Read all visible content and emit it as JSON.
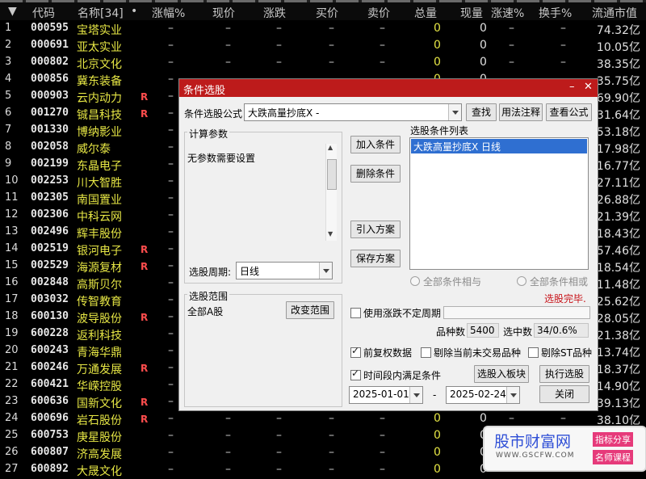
{
  "colors": {
    "header_bg": "#0b0b0b",
    "name": "#e6e645",
    "flag": "#ff4d4d",
    "dialog_title": "#bd1b1b",
    "selected": "#1a2f8a"
  },
  "header": {
    "sort_icon": "▼",
    "cols": [
      "代码",
      "名称[34]",
      "•",
      "涨幅%",
      "现价",
      "涨跌",
      "买价",
      "卖价",
      "总量",
      "现量",
      "涨速%",
      "换手%",
      "流通市值"
    ]
  },
  "rows": [
    {
      "idx": "1",
      "code": "000595",
      "name": "宝塔实业",
      "flag": "",
      "zong": "0",
      "xian": "0",
      "cap": "74.32亿"
    },
    {
      "idx": "2",
      "code": "000691",
      "name": "亚太实业",
      "flag": "",
      "zong": "0",
      "xian": "0",
      "cap": "10.05亿"
    },
    {
      "idx": "3",
      "code": "000802",
      "name": "北京文化",
      "flag": "",
      "zong": "0",
      "xian": "0",
      "cap": "38.35亿"
    },
    {
      "idx": "4",
      "code": "000856",
      "name": "冀东装备",
      "flag": "",
      "zong": "0",
      "xian": "0",
      "cap": "35.75亿"
    },
    {
      "idx": "5",
      "code": "000903",
      "name": "云内动力",
      "flag": "R",
      "zong": "",
      "xian": "",
      "cap": "69.90亿"
    },
    {
      "idx": "6",
      "code": "001270",
      "name": "铖昌科技",
      "flag": "R",
      "zong": "",
      "xian": "",
      "cap": "31.64亿"
    },
    {
      "idx": "7",
      "code": "001330",
      "name": "博纳影业",
      "flag": "",
      "zong": "",
      "xian": "",
      "cap": "53.18亿"
    },
    {
      "idx": "8",
      "code": "002058",
      "name": "威尔泰",
      "flag": "",
      "zong": "",
      "xian": "",
      "cap": "17.98亿"
    },
    {
      "idx": "9",
      "code": "002199",
      "name": "东晶电子",
      "flag": "",
      "zong": "",
      "xian": "",
      "cap": "16.77亿"
    },
    {
      "idx": "10",
      "code": "002253",
      "name": "川大智胜",
      "flag": "",
      "zong": "",
      "xian": "",
      "cap": "27.11亿"
    },
    {
      "idx": "11",
      "code": "002305",
      "name": "南国置业",
      "flag": "",
      "zong": "",
      "xian": "",
      "cap": "26.88亿"
    },
    {
      "idx": "12",
      "code": "002306",
      "name": "中科云网",
      "flag": "",
      "zong": "",
      "xian": "",
      "cap": "21.39亿"
    },
    {
      "idx": "13",
      "code": "002496",
      "name": "辉丰股份",
      "flag": "",
      "zong": "",
      "xian": "",
      "cap": "18.43亿"
    },
    {
      "idx": "14",
      "code": "002519",
      "name": "银河电子",
      "flag": "R",
      "zong": "",
      "xian": "",
      "cap": "57.46亿"
    },
    {
      "idx": "15",
      "code": "002529",
      "name": "海源复材",
      "flag": "R",
      "zong": "",
      "xian": "",
      "cap": "18.54亿"
    },
    {
      "idx": "16",
      "code": "002848",
      "name": "高斯贝尔",
      "flag": "",
      "zong": "",
      "xian": "",
      "cap": "11.48亿"
    },
    {
      "idx": "17",
      "code": "003032",
      "name": "传智教育",
      "flag": "",
      "zong": "",
      "xian": "",
      "cap": "25.62亿"
    },
    {
      "idx": "18",
      "code": "600130",
      "name": "波导股份",
      "flag": "R",
      "zong": "",
      "xian": "",
      "cap": "28.05亿"
    },
    {
      "idx": "19",
      "code": "600228",
      "name": "返利科技",
      "flag": "",
      "zong": "",
      "xian": "",
      "cap": "21.38亿"
    },
    {
      "idx": "20",
      "code": "600243",
      "name": "青海华鼎",
      "flag": "",
      "zong": "",
      "xian": "",
      "cap": "13.74亿"
    },
    {
      "idx": "21",
      "code": "600246",
      "name": "万通发展",
      "flag": "R",
      "zong": "",
      "xian": "",
      "cap": "118.37亿"
    },
    {
      "idx": "22",
      "code": "600421",
      "name": "华嵘控股",
      "flag": "",
      "zong": "",
      "xian": "",
      "cap": "14.90亿"
    },
    {
      "idx": "23",
      "code": "600636",
      "name": "国新文化",
      "flag": "R",
      "zong": "",
      "xian": "",
      "cap": "39.13亿"
    },
    {
      "idx": "24",
      "code": "600696",
      "name": "岩石股份",
      "flag": "R",
      "zong": "0",
      "xian": "0",
      "cap": "38.10亿"
    },
    {
      "idx": "25",
      "code": "600753",
      "name": "庚星股份",
      "flag": "",
      "zong": "0",
      "xian": "0",
      "cap": ""
    },
    {
      "idx": "26",
      "code": "600807",
      "name": "济高发展",
      "flag": "",
      "zong": "0",
      "xian": "0",
      "cap": ""
    },
    {
      "idx": "27",
      "code": "600892",
      "name": "大晟文化",
      "flag": "",
      "zong": "0",
      "xian": "0",
      "cap": ""
    }
  ],
  "dash": "–",
  "dialog": {
    "title": "条件选股",
    "minimize_icon": "–",
    "close_icon": "✕",
    "formula_label": "条件选股公式",
    "formula_value": "大跌高量抄底X  -",
    "btn_search": "查找",
    "btn_usage": "用法注释",
    "btn_view": "查看公式",
    "params_label": "计算参数",
    "params_text": "无参数需要设置",
    "btn_add": "加入条件",
    "btn_delete": "删除条件",
    "btn_import": "引入方案",
    "btn_save": "保存方案",
    "list_label": "选股条件列表",
    "list_item": "大跌高量抄底X  日线",
    "period_label": "选股周期:",
    "period_value": "日线",
    "radio_and": "全部条件相与",
    "radio_or": "全部条件相或",
    "status": "选股完毕.",
    "range_label": "选股范围",
    "range_value": "全部A股",
    "btn_change_range": "改变范围",
    "uncertain_period": "使用涨跌不定周期",
    "count_label": "品种数",
    "count_value": "5400",
    "selected_label": "选中数",
    "selected_value": "34/0.6%",
    "fq_label": "前复权数据",
    "exclude_untraded": "剔除当前未交易品种",
    "exclude_st": "剔除ST品种",
    "time_range_label": "时间段内满足条件",
    "btn_to_block": "选股入板块",
    "btn_run": "执行选股",
    "date_from": "2025-01-01",
    "date_sep": "-",
    "date_to": "2025-02-24",
    "btn_close": "关闭"
  },
  "watermark": {
    "title": "股市财富网",
    "url": "WWW.GSCFW.COM",
    "tag1": "指标分享",
    "tag2": "名师课程"
  }
}
